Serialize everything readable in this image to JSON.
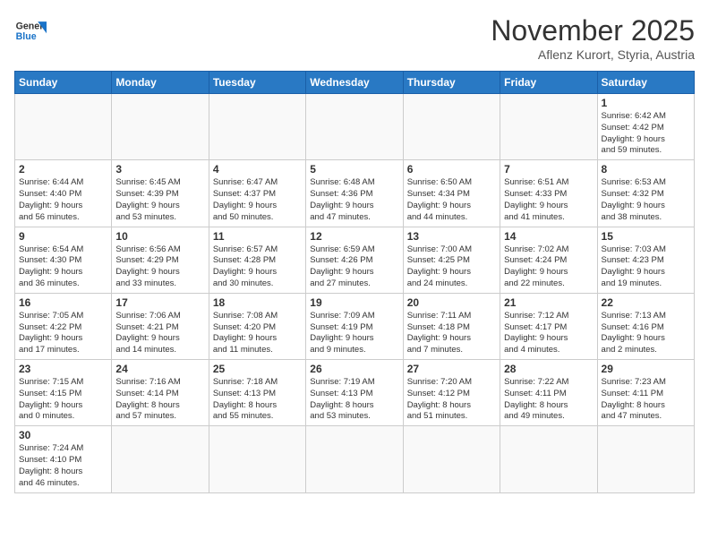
{
  "header": {
    "logo_general": "General",
    "logo_blue": "Blue",
    "month_title": "November 2025",
    "location": "Aflenz Kurort, Styria, Austria"
  },
  "days_of_week": [
    "Sunday",
    "Monday",
    "Tuesday",
    "Wednesday",
    "Thursday",
    "Friday",
    "Saturday"
  ],
  "weeks": [
    [
      {
        "day": "",
        "info": ""
      },
      {
        "day": "",
        "info": ""
      },
      {
        "day": "",
        "info": ""
      },
      {
        "day": "",
        "info": ""
      },
      {
        "day": "",
        "info": ""
      },
      {
        "day": "",
        "info": ""
      },
      {
        "day": "1",
        "info": "Sunrise: 6:42 AM\nSunset: 4:42 PM\nDaylight: 9 hours\nand 59 minutes."
      }
    ],
    [
      {
        "day": "2",
        "info": "Sunrise: 6:44 AM\nSunset: 4:40 PM\nDaylight: 9 hours\nand 56 minutes."
      },
      {
        "day": "3",
        "info": "Sunrise: 6:45 AM\nSunset: 4:39 PM\nDaylight: 9 hours\nand 53 minutes."
      },
      {
        "day": "4",
        "info": "Sunrise: 6:47 AM\nSunset: 4:37 PM\nDaylight: 9 hours\nand 50 minutes."
      },
      {
        "day": "5",
        "info": "Sunrise: 6:48 AM\nSunset: 4:36 PM\nDaylight: 9 hours\nand 47 minutes."
      },
      {
        "day": "6",
        "info": "Sunrise: 6:50 AM\nSunset: 4:34 PM\nDaylight: 9 hours\nand 44 minutes."
      },
      {
        "day": "7",
        "info": "Sunrise: 6:51 AM\nSunset: 4:33 PM\nDaylight: 9 hours\nand 41 minutes."
      },
      {
        "day": "8",
        "info": "Sunrise: 6:53 AM\nSunset: 4:32 PM\nDaylight: 9 hours\nand 38 minutes."
      }
    ],
    [
      {
        "day": "9",
        "info": "Sunrise: 6:54 AM\nSunset: 4:30 PM\nDaylight: 9 hours\nand 36 minutes."
      },
      {
        "day": "10",
        "info": "Sunrise: 6:56 AM\nSunset: 4:29 PM\nDaylight: 9 hours\nand 33 minutes."
      },
      {
        "day": "11",
        "info": "Sunrise: 6:57 AM\nSunset: 4:28 PM\nDaylight: 9 hours\nand 30 minutes."
      },
      {
        "day": "12",
        "info": "Sunrise: 6:59 AM\nSunset: 4:26 PM\nDaylight: 9 hours\nand 27 minutes."
      },
      {
        "day": "13",
        "info": "Sunrise: 7:00 AM\nSunset: 4:25 PM\nDaylight: 9 hours\nand 24 minutes."
      },
      {
        "day": "14",
        "info": "Sunrise: 7:02 AM\nSunset: 4:24 PM\nDaylight: 9 hours\nand 22 minutes."
      },
      {
        "day": "15",
        "info": "Sunrise: 7:03 AM\nSunset: 4:23 PM\nDaylight: 9 hours\nand 19 minutes."
      }
    ],
    [
      {
        "day": "16",
        "info": "Sunrise: 7:05 AM\nSunset: 4:22 PM\nDaylight: 9 hours\nand 17 minutes."
      },
      {
        "day": "17",
        "info": "Sunrise: 7:06 AM\nSunset: 4:21 PM\nDaylight: 9 hours\nand 14 minutes."
      },
      {
        "day": "18",
        "info": "Sunrise: 7:08 AM\nSunset: 4:20 PM\nDaylight: 9 hours\nand 11 minutes."
      },
      {
        "day": "19",
        "info": "Sunrise: 7:09 AM\nSunset: 4:19 PM\nDaylight: 9 hours\nand 9 minutes."
      },
      {
        "day": "20",
        "info": "Sunrise: 7:11 AM\nSunset: 4:18 PM\nDaylight: 9 hours\nand 7 minutes."
      },
      {
        "day": "21",
        "info": "Sunrise: 7:12 AM\nSunset: 4:17 PM\nDaylight: 9 hours\nand 4 minutes."
      },
      {
        "day": "22",
        "info": "Sunrise: 7:13 AM\nSunset: 4:16 PM\nDaylight: 9 hours\nand 2 minutes."
      }
    ],
    [
      {
        "day": "23",
        "info": "Sunrise: 7:15 AM\nSunset: 4:15 PM\nDaylight: 9 hours\nand 0 minutes."
      },
      {
        "day": "24",
        "info": "Sunrise: 7:16 AM\nSunset: 4:14 PM\nDaylight: 8 hours\nand 57 minutes."
      },
      {
        "day": "25",
        "info": "Sunrise: 7:18 AM\nSunset: 4:13 PM\nDaylight: 8 hours\nand 55 minutes."
      },
      {
        "day": "26",
        "info": "Sunrise: 7:19 AM\nSunset: 4:13 PM\nDaylight: 8 hours\nand 53 minutes."
      },
      {
        "day": "27",
        "info": "Sunrise: 7:20 AM\nSunset: 4:12 PM\nDaylight: 8 hours\nand 51 minutes."
      },
      {
        "day": "28",
        "info": "Sunrise: 7:22 AM\nSunset: 4:11 PM\nDaylight: 8 hours\nand 49 minutes."
      },
      {
        "day": "29",
        "info": "Sunrise: 7:23 AM\nSunset: 4:11 PM\nDaylight: 8 hours\nand 47 minutes."
      }
    ],
    [
      {
        "day": "30",
        "info": "Sunrise: 7:24 AM\nSunset: 4:10 PM\nDaylight: 8 hours\nand 46 minutes."
      },
      {
        "day": "",
        "info": ""
      },
      {
        "day": "",
        "info": ""
      },
      {
        "day": "",
        "info": ""
      },
      {
        "day": "",
        "info": ""
      },
      {
        "day": "",
        "info": ""
      },
      {
        "day": "",
        "info": ""
      }
    ]
  ]
}
